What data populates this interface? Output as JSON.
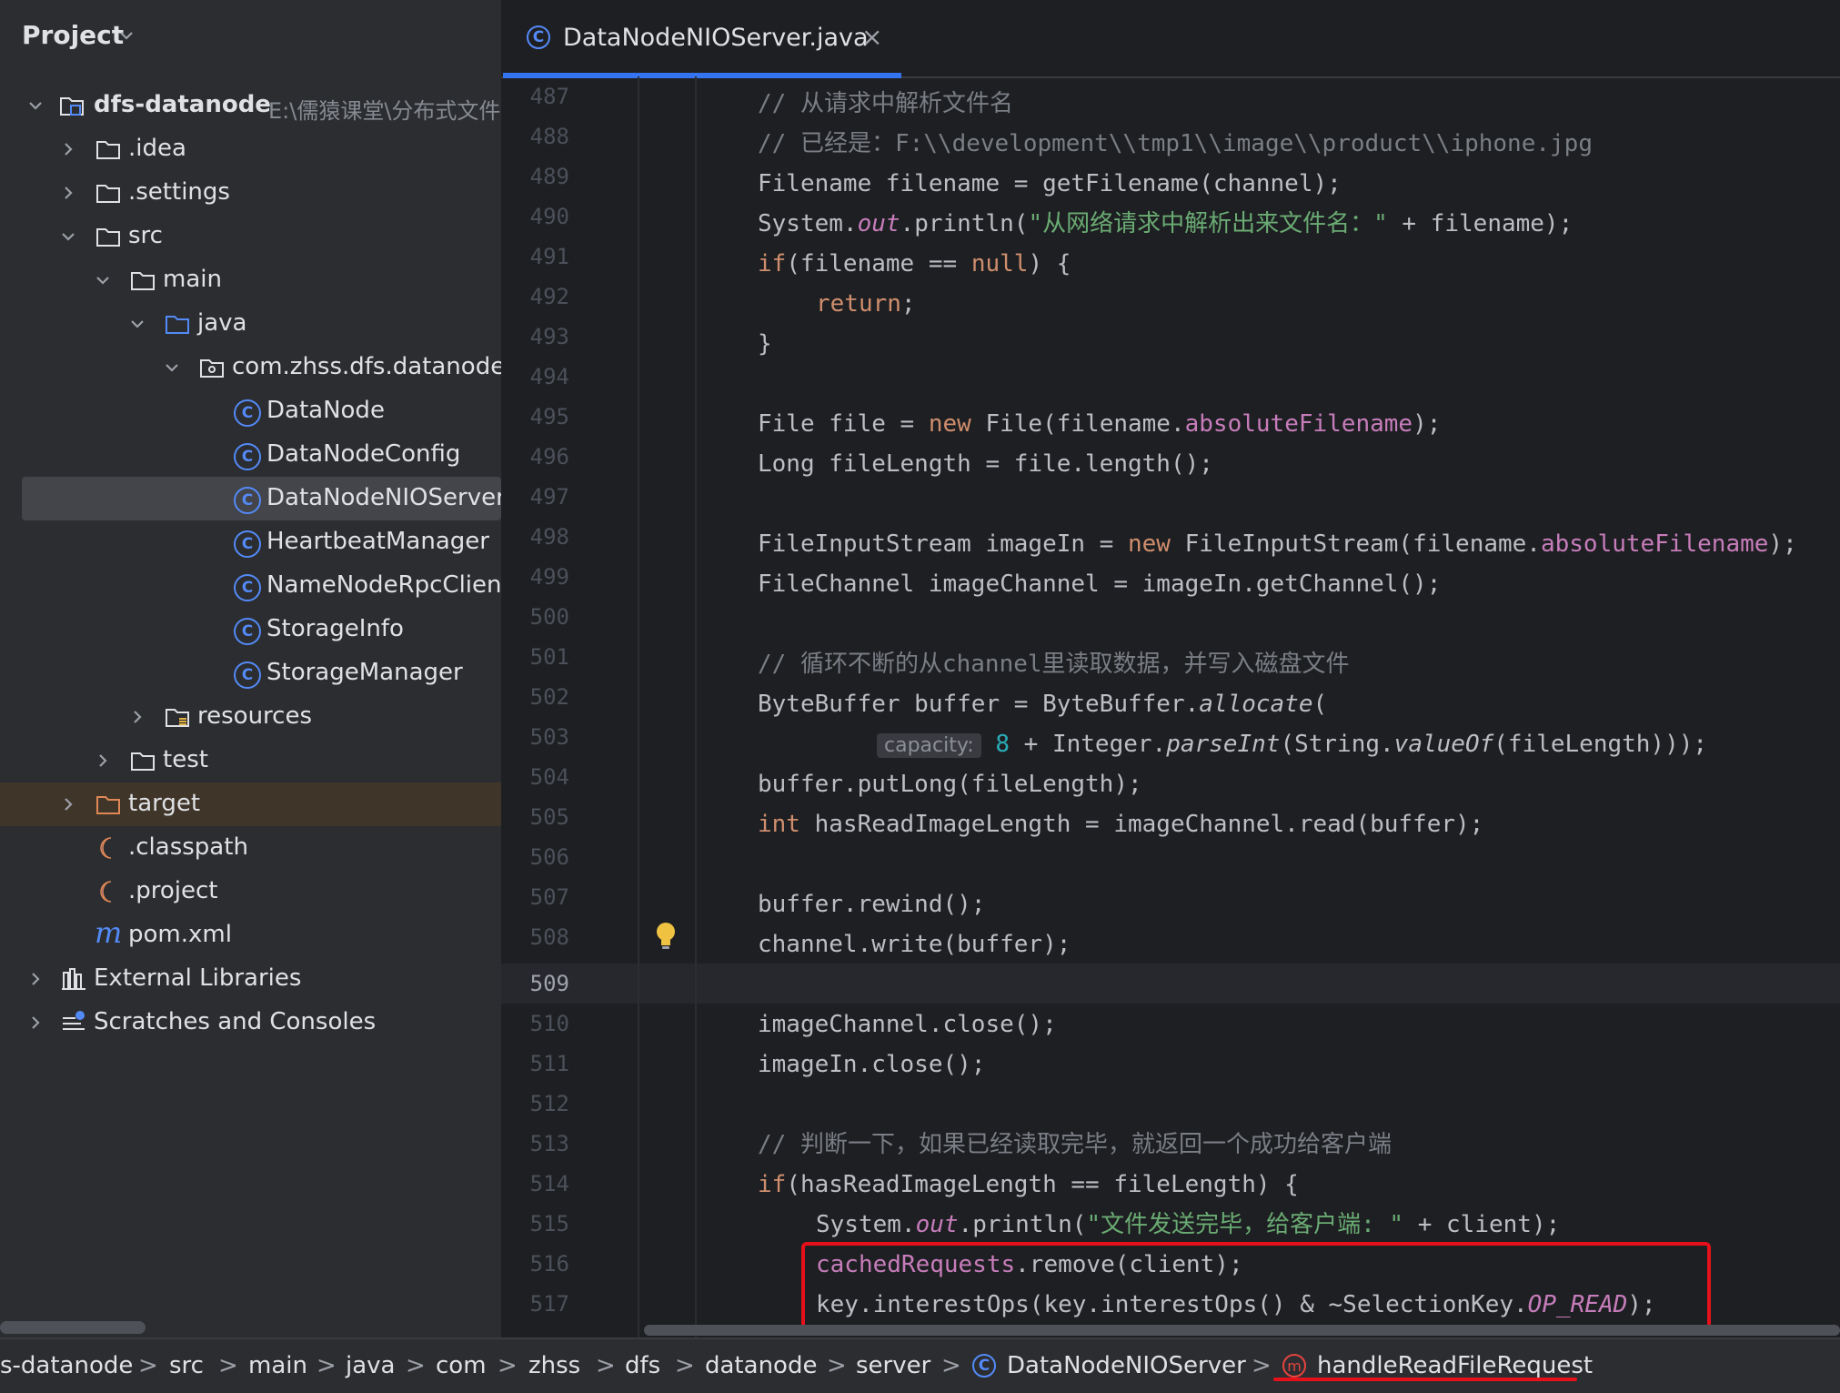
{
  "project_panel": {
    "title": "Project",
    "tree": [
      {
        "label": "dfs-datanode",
        "path": "E:\\儒猿课堂\\分布式文件"
      },
      {
        "label": ".idea"
      },
      {
        "label": ".settings"
      },
      {
        "label": "src"
      },
      {
        "label": "main"
      },
      {
        "label": "java"
      },
      {
        "label": "com.zhss.dfs.datanode."
      },
      {
        "label": "DataNode"
      },
      {
        "label": "DataNodeConfig"
      },
      {
        "label": "DataNodeNIOServer"
      },
      {
        "label": "HeartbeatManager"
      },
      {
        "label": "NameNodeRpcClient"
      },
      {
        "label": "StorageInfo"
      },
      {
        "label": "StorageManager"
      },
      {
        "label": "resources"
      },
      {
        "label": "test"
      },
      {
        "label": "target"
      },
      {
        "label": ".classpath"
      },
      {
        "label": ".project"
      },
      {
        "label": "pom.xml"
      },
      {
        "label": "External Libraries"
      },
      {
        "label": "Scratches and Consoles"
      }
    ]
  },
  "editor": {
    "tab": {
      "label": "DataNodeNIOServer.java",
      "close": "×"
    },
    "active_line": "509",
    "lines": [
      {
        "n": "487"
      },
      {
        "n": "488"
      },
      {
        "n": "489"
      },
      {
        "n": "490"
      },
      {
        "n": "491"
      },
      {
        "n": "492"
      },
      {
        "n": "493"
      },
      {
        "n": "494"
      },
      {
        "n": "495"
      },
      {
        "n": "496"
      },
      {
        "n": "497"
      },
      {
        "n": "498"
      },
      {
        "n": "499"
      },
      {
        "n": "500"
      },
      {
        "n": "501"
      },
      {
        "n": "502"
      },
      {
        "n": "503"
      },
      {
        "n": "504"
      },
      {
        "n": "505"
      },
      {
        "n": "506"
      },
      {
        "n": "507"
      },
      {
        "n": "508"
      },
      {
        "n": "509"
      },
      {
        "n": "510"
      },
      {
        "n": "511"
      },
      {
        "n": "512"
      },
      {
        "n": "513"
      },
      {
        "n": "514"
      },
      {
        "n": "515"
      },
      {
        "n": "516"
      },
      {
        "n": "517"
      }
    ],
    "code": {
      "l487": "// 从请求中解析文件名",
      "l488": "// 已经是：F:\\\\development\\\\tmp1\\\\image\\\\product\\\\iphone.jpg",
      "l489": "Filename filename = getFilename(channel);",
      "l490_a": "System.",
      "l490_b": "out",
      "l490_c": ".println(",
      "l490_d": "\"从网络请求中解析出来文件名：\"",
      "l490_e": " + filename);",
      "l491_a": "if",
      "l491_b": "(filename == ",
      "l491_c": "null",
      "l491_d": ") {",
      "l492": "return",
      "l492_b": ";",
      "l493": "}",
      "l495_a": "File file = ",
      "l495_b": "new",
      "l495_c": " File(filename.",
      "l495_d": "absoluteFilename",
      "l495_e": ");",
      "l496": "Long fileLength = file.length();",
      "l498_a": "FileInputStream imageIn = ",
      "l498_b": "new",
      "l498_c": " FileInputStream(filename.",
      "l498_d": "absoluteFilename",
      "l498_e": ");",
      "l499": "FileChannel imageChannel = imageIn.getChannel();",
      "l501": "// 循环不断的从channel里读取数据，并写入磁盘文件",
      "l502_a": "ByteBuffer buffer = ByteBuffer.",
      "l502_b": "allocate",
      "l502_c": "(",
      "l503_hint": "capacity:",
      "l503_a": "8",
      "l503_b": " + Integer.",
      "l503_c": "parseInt",
      "l503_d": "(String.",
      "l503_e": "valueOf",
      "l503_f": "(fileLength)));",
      "l504": "buffer.putLong(fileLength);",
      "l505_a": "int",
      "l505_b": " hasReadImageLength = imageChannel.read(buffer);",
      "l507": "buffer.rewind();",
      "l508": "channel.write(buffer);",
      "l510": "imageChannel.close();",
      "l511": "imageIn.close();",
      "l513": "// 判断一下，如果已经读取完毕，就返回一个成功给客户端",
      "l514_a": "if",
      "l514_b": "(hasReadImageLength == fileLength) {",
      "l515_a": "System.",
      "l515_b": "out",
      "l515_c": ".println(",
      "l515_d": "\"文件发送完毕，给客户端: \"",
      "l515_e": " + client);",
      "l516_a": "cachedRequests",
      "l516_b": ".remove(client);",
      "l517_a": "key.interestOps(key.interestOps() & ~SelectionKey.",
      "l517_b": "OP_READ",
      "l517_c": ");"
    }
  },
  "breadcrumb": {
    "items": [
      "s-datanode",
      "src",
      "main",
      "java",
      "com",
      "zhss",
      "dfs",
      "datanode",
      "server",
      "DataNodeNIOServer",
      "handleReadFileRequest"
    ],
    "separator": ">"
  },
  "colors": {
    "accent": "#3574f0",
    "highlight_red": "#e5101a",
    "keyword": "#cf8e6d",
    "string": "#6aab73",
    "field": "#c77dbb"
  }
}
